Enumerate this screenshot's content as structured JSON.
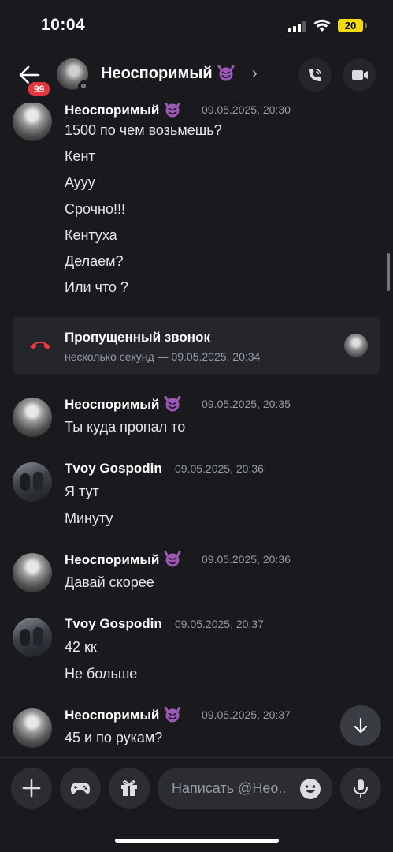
{
  "status": {
    "time": "10:04",
    "battery": "20"
  },
  "header": {
    "back_badge": "99",
    "name": "Неоспоримый",
    "chevron": "›",
    "call_icon": "phone-icon",
    "video_icon": "video-icon"
  },
  "users": {
    "neo": "Неоспоримый",
    "tvoy": "Tvoy Gospodin"
  },
  "messages": [
    {
      "author": "Неоспоримый",
      "time": "09.05.2025, 20:30",
      "lines": [
        "1500 по чем возьмешь?",
        "Кент",
        "Аууу",
        "Срочно!!!",
        "Кентуха",
        "Делаем?",
        "Или что ?"
      ]
    },
    {
      "author": "Неоспоримый",
      "time": "09.05.2025, 20:35",
      "lines": [
        "Ты куда пропал то"
      ]
    },
    {
      "author": "Tvoy Gospodin",
      "time": "09.05.2025, 20:36",
      "lines": [
        "Я тут",
        "Минуту"
      ]
    },
    {
      "author": "Неоспоримый",
      "time": "09.05.2025, 20:36",
      "lines": [
        "Давай скорее"
      ]
    },
    {
      "author": "Tvoy Gospodin",
      "time": "09.05.2025, 20:37",
      "lines": [
        "42 кк",
        "Не больше"
      ]
    },
    {
      "author": "Неоспоримый",
      "time": "09.05.2025, 20:37",
      "lines": [
        "45 и по рукам?"
      ]
    }
  ],
  "missed_call": {
    "title": "Пропущенный звонок",
    "subtitle": "несколько секунд — 09.05.2025, 20:34"
  },
  "composer": {
    "placeholder": "Написать @Нео..",
    "buttons": [
      "plus-icon",
      "gamepad-icon",
      "gift-icon",
      "emoji-icon",
      "microphone-icon"
    ]
  },
  "colors": {
    "background": "#1a1a1e",
    "card": "#25262b",
    "timestamp": "#949ba4",
    "emoji_purple": "#9b59b6",
    "missed_call_red": "#e5383b",
    "battery_yellow": "#f5d90a"
  }
}
